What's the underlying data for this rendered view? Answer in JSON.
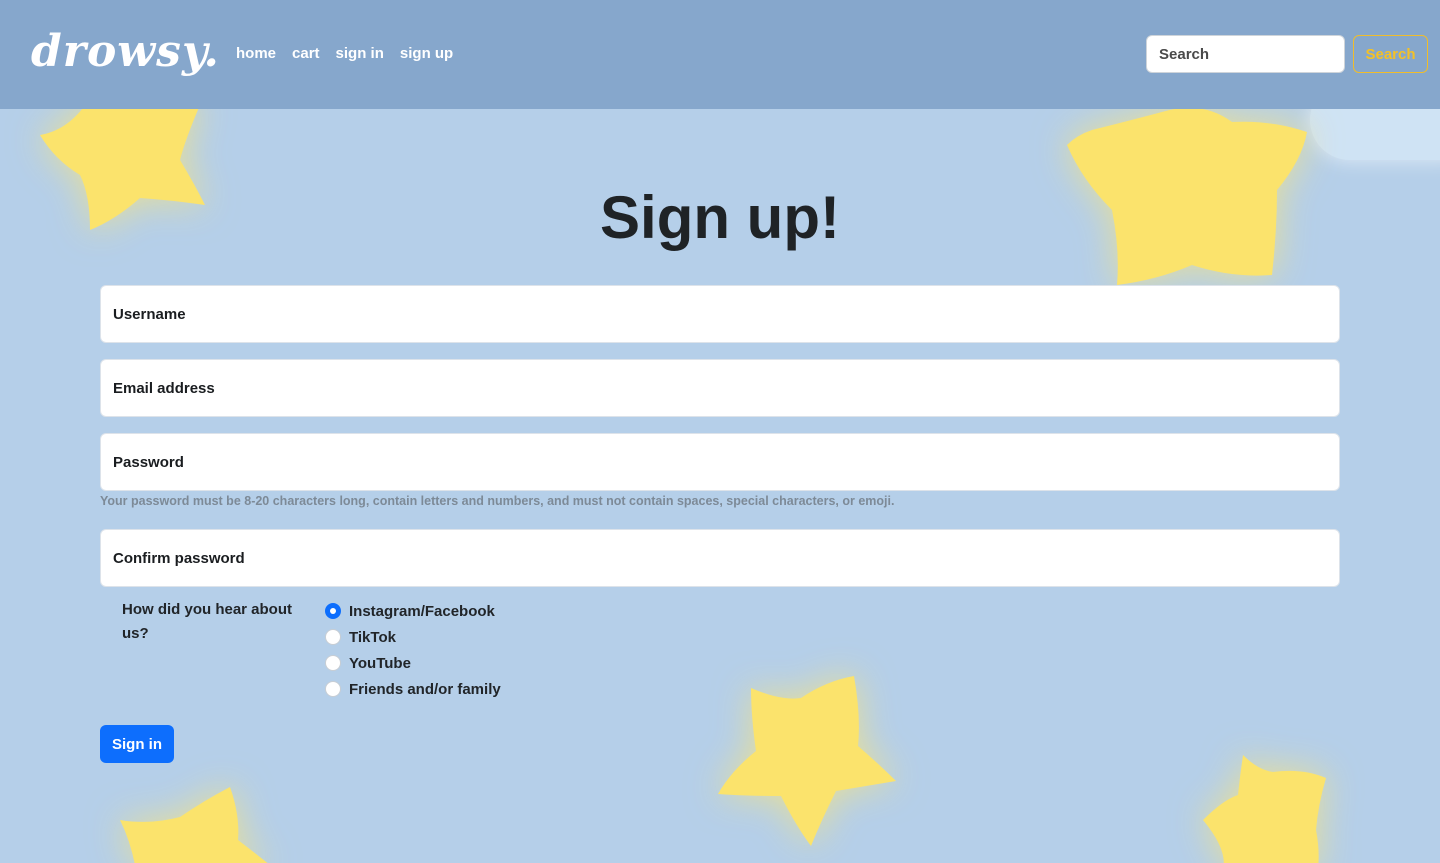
{
  "brand": {
    "name": "drowsy."
  },
  "nav": {
    "links": [
      {
        "label": "home"
      },
      {
        "label": "cart"
      },
      {
        "label": "sign in"
      },
      {
        "label": "sign up"
      }
    ]
  },
  "search": {
    "placeholder": "Search",
    "button_label": "Search"
  },
  "main": {
    "title": "Sign up!",
    "fields": {
      "username": {
        "placeholder": "Username",
        "value": ""
      },
      "email": {
        "placeholder": "Email address",
        "value": ""
      },
      "password": {
        "placeholder": "Password",
        "value": ""
      },
      "confirm_password": {
        "placeholder": "Confirm password",
        "value": ""
      }
    },
    "password_help": "Your password must be 8-20 characters long, contain letters and numbers, and must not contain spaces, special characters, or emoji.",
    "referral": {
      "label": "How did you hear about us?",
      "options": [
        {
          "label": "Instagram/Facebook",
          "selected": true
        },
        {
          "label": "TikTok",
          "selected": false
        },
        {
          "label": "YouTube",
          "selected": false
        },
        {
          "label": "Friends and/or family",
          "selected": false
        }
      ]
    },
    "submit_label": "Sign in"
  },
  "colors": {
    "background": "#b5cfe9",
    "navbar": "#86a7cc",
    "star": "#fbe36c",
    "primary": "#0d6efd",
    "search_accent": "#f4c127"
  }
}
